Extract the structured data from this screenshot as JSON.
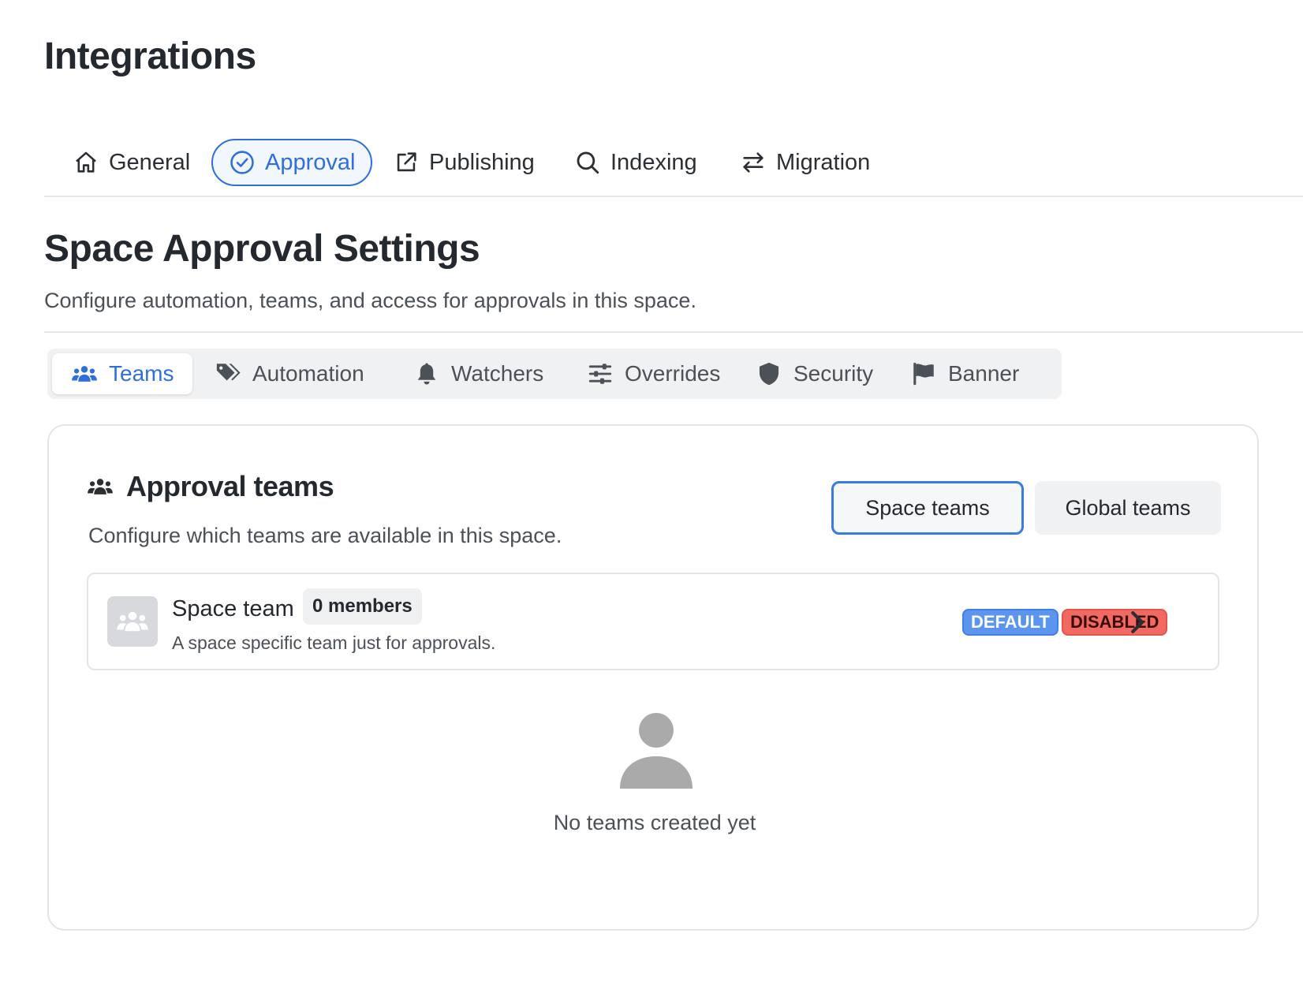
{
  "page": {
    "title": "Integrations"
  },
  "top_tabs": [
    {
      "label": "General",
      "icon": "home-icon"
    },
    {
      "label": "Approval",
      "icon": "check-circle-icon",
      "active": true
    },
    {
      "label": "Publishing",
      "icon": "share-icon"
    },
    {
      "label": "Indexing",
      "icon": "search-icon"
    },
    {
      "label": "Migration",
      "icon": "arrows-swap-icon"
    }
  ],
  "section": {
    "title": "Space Approval Settings",
    "description": "Configure automation, teams, and access for approvals in this space."
  },
  "sub_tabs": [
    {
      "label": "Teams",
      "icon": "users-icon",
      "active": true
    },
    {
      "label": "Automation",
      "icon": "tags-icon"
    },
    {
      "label": "Watchers",
      "icon": "bell-icon"
    },
    {
      "label": "Overrides",
      "icon": "sliders-icon"
    },
    {
      "label": "Security",
      "icon": "shield-icon"
    },
    {
      "label": "Banner",
      "icon": "flag-icon"
    }
  ],
  "card": {
    "title": "Approval teams",
    "description": "Configure which teams are available in this space.",
    "toggle": {
      "space": "Space teams",
      "global": "Global teams",
      "selected": "space"
    },
    "team": {
      "name": "Space team",
      "members": "0 members",
      "description": "A space specific team just for approvals.",
      "badges": {
        "default": "DEFAULT",
        "disabled": "DISABLED"
      }
    },
    "empty_state": {
      "text": "No teams created yet"
    }
  },
  "colors": {
    "accent": "#2f6fdc",
    "badge_default": "#5b95ee",
    "badge_disabled": "#f06a62"
  }
}
